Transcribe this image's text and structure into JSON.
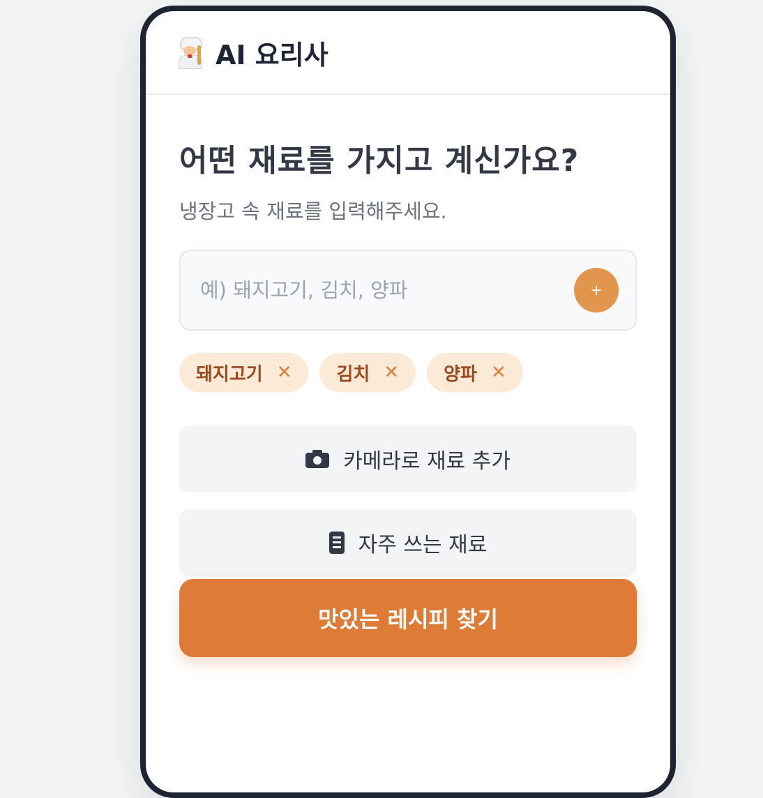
{
  "header": {
    "title": "AI 요리사",
    "icon": "chef-icon"
  },
  "main": {
    "heading": "어떤 재료를 가지고 계신가요?",
    "subheading": "냉장고 속 재료를 입력해주세요.",
    "input": {
      "placeholder": "예) 돼지고기, 김치, 양파",
      "value": ""
    },
    "add_button_label": "+",
    "chips": [
      {
        "label": "돼지고기",
        "remove": "✕"
      },
      {
        "label": "김치",
        "remove": "✕"
      },
      {
        "label": "양파",
        "remove": "✕"
      }
    ],
    "camera_button_label": "카메라로 재료 추가",
    "favorites_button_label": "자주 쓰는 재료",
    "search_button_label": "맛있는 레시피 찾기"
  },
  "colors": {
    "accent": "#de7b37",
    "add_button": "#e2964d",
    "chip_bg": "#fbead6",
    "chip_text": "#9a4a1e"
  }
}
